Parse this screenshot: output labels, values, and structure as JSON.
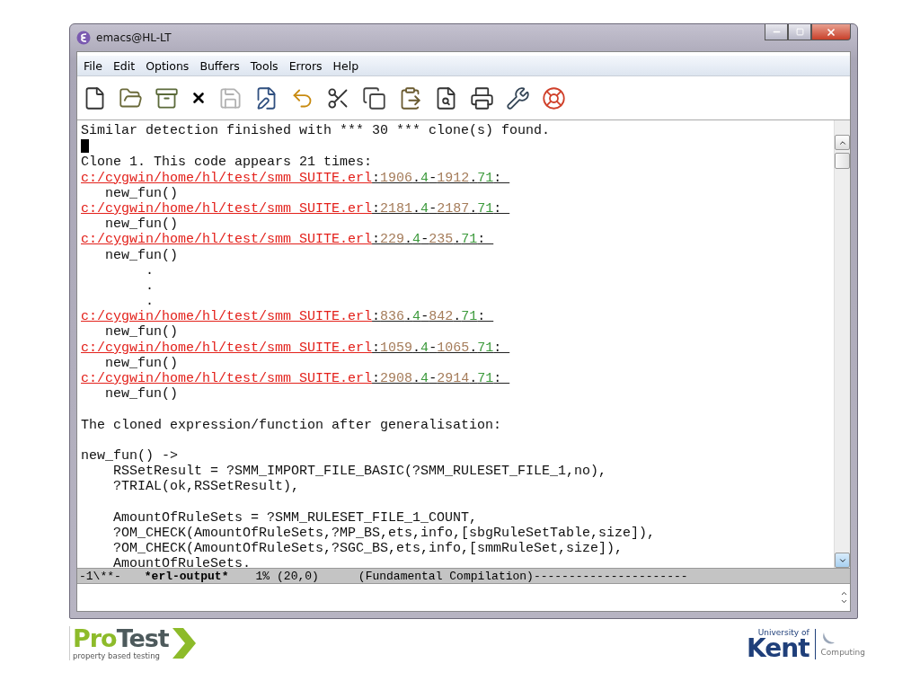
{
  "window": {
    "title": "emacs@HL-LT"
  },
  "menu": [
    "File",
    "Edit",
    "Options",
    "Buffers",
    "Tools",
    "Errors",
    "Help"
  ],
  "toolbar": [
    {
      "kind": "new",
      "disabled": false
    },
    {
      "kind": "open",
      "disabled": false
    },
    {
      "kind": "dired",
      "disabled": false
    },
    {
      "kind": "close",
      "disabled": false
    },
    {
      "kind": "save",
      "disabled": true
    },
    {
      "kind": "saveas",
      "disabled": false
    },
    {
      "kind": "undo",
      "disabled": false
    },
    {
      "kind": "cut",
      "disabled": false
    },
    {
      "kind": "copy",
      "disabled": false
    },
    {
      "kind": "paste",
      "disabled": false
    },
    {
      "kind": "search",
      "disabled": false
    },
    {
      "kind": "print",
      "disabled": false
    },
    {
      "kind": "preferences",
      "disabled": false
    },
    {
      "kind": "help",
      "disabled": false
    }
  ],
  "buffer": [
    {
      "kind": "text",
      "text": "Similar detection finished with *** 30 *** clone(s) found."
    },
    {
      "kind": "cursor"
    },
    {
      "kind": "text",
      "text": "Clone 1. This code appears 21 times:"
    },
    {
      "kind": "location",
      "path": "c:/cygwin/home/hl/test/smm_SUITE.erl",
      "parts": [
        {
          "kind": "sep",
          "text": ":"
        },
        {
          "kind": "line",
          "text": "1906"
        },
        {
          "kind": "sep",
          "text": "."
        },
        {
          "kind": "col",
          "text": "4"
        },
        {
          "kind": "sep",
          "text": "-"
        },
        {
          "kind": "line",
          "text": "1912"
        },
        {
          "kind": "sep",
          "text": "."
        },
        {
          "kind": "col",
          "text": "71"
        },
        {
          "kind": "sep",
          "text": ": "
        }
      ]
    },
    {
      "kind": "text",
      "text": "   new_fun()"
    },
    {
      "kind": "location",
      "path": "c:/cygwin/home/hl/test/smm_SUITE.erl",
      "parts": [
        {
          "kind": "sep",
          "text": ":"
        },
        {
          "kind": "line",
          "text": "2181"
        },
        {
          "kind": "sep",
          "text": "."
        },
        {
          "kind": "col",
          "text": "4"
        },
        {
          "kind": "sep",
          "text": "-"
        },
        {
          "kind": "line",
          "text": "2187"
        },
        {
          "kind": "sep",
          "text": "."
        },
        {
          "kind": "col",
          "text": "71"
        },
        {
          "kind": "sep",
          "text": ": "
        }
      ]
    },
    {
      "kind": "text",
      "text": "   new_fun()"
    },
    {
      "kind": "location",
      "path": "c:/cygwin/home/hl/test/smm_SUITE.erl",
      "parts": [
        {
          "kind": "sep",
          "text": ":"
        },
        {
          "kind": "line",
          "text": "229"
        },
        {
          "kind": "sep",
          "text": "."
        },
        {
          "kind": "col",
          "text": "4"
        },
        {
          "kind": "sep",
          "text": "-"
        },
        {
          "kind": "line",
          "text": "235"
        },
        {
          "kind": "sep",
          "text": "."
        },
        {
          "kind": "col",
          "text": "71"
        },
        {
          "kind": "sep",
          "text": ": "
        }
      ]
    },
    {
      "kind": "text",
      "text": "   new_fun()"
    },
    {
      "kind": "text",
      "text": "        ."
    },
    {
      "kind": "text",
      "text": "        ."
    },
    {
      "kind": "text",
      "text": "        ."
    },
    {
      "kind": "location",
      "path": "c:/cygwin/home/hl/test/smm_SUITE.erl",
      "parts": [
        {
          "kind": "sep",
          "text": ":"
        },
        {
          "kind": "line",
          "text": "836"
        },
        {
          "kind": "sep",
          "text": "."
        },
        {
          "kind": "col",
          "text": "4"
        },
        {
          "kind": "sep",
          "text": "-"
        },
        {
          "kind": "line",
          "text": "842"
        },
        {
          "kind": "sep",
          "text": "."
        },
        {
          "kind": "col",
          "text": "71"
        },
        {
          "kind": "sep",
          "text": ": "
        }
      ]
    },
    {
      "kind": "text",
      "text": "   new_fun()"
    },
    {
      "kind": "location",
      "path": "c:/cygwin/home/hl/test/smm_SUITE.erl",
      "parts": [
        {
          "kind": "sep",
          "text": ":"
        },
        {
          "kind": "line",
          "text": "1059"
        },
        {
          "kind": "sep",
          "text": "."
        },
        {
          "kind": "col",
          "text": "4"
        },
        {
          "kind": "sep",
          "text": "-"
        },
        {
          "kind": "line",
          "text": "1065"
        },
        {
          "kind": "sep",
          "text": "."
        },
        {
          "kind": "col",
          "text": "71"
        },
        {
          "kind": "sep",
          "text": ": "
        }
      ]
    },
    {
      "kind": "text",
      "text": "   new_fun()"
    },
    {
      "kind": "location",
      "path": "c:/cygwin/home/hl/test/smm_SUITE.erl",
      "parts": [
        {
          "kind": "sep",
          "text": ":"
        },
        {
          "kind": "line",
          "text": "2908"
        },
        {
          "kind": "sep",
          "text": "."
        },
        {
          "kind": "col",
          "text": "4"
        },
        {
          "kind": "sep",
          "text": "-"
        },
        {
          "kind": "line",
          "text": "2914"
        },
        {
          "kind": "sep",
          "text": "."
        },
        {
          "kind": "col",
          "text": "71"
        },
        {
          "kind": "sep",
          "text": ": "
        }
      ]
    },
    {
      "kind": "text",
      "text": "   new_fun()"
    },
    {
      "kind": "blank"
    },
    {
      "kind": "text",
      "text": "The cloned expression/function after generalisation:"
    },
    {
      "kind": "blank"
    },
    {
      "kind": "text",
      "text": "new_fun() ->"
    },
    {
      "kind": "text",
      "text": "    RSSetResult = ?SMM_IMPORT_FILE_BASIC(?SMM_RULESET_FILE_1,no),"
    },
    {
      "kind": "text",
      "text": "    ?TRIAL(ok,RSSetResult),"
    },
    {
      "kind": "blank"
    },
    {
      "kind": "text",
      "text": "    AmountOfRuleSets = ?SMM_RULESET_FILE_1_COUNT,"
    },
    {
      "kind": "text",
      "text": "    ?OM_CHECK(AmountOfRuleSets,?MP_BS,ets,info,[sbgRuleSetTable,size]),"
    },
    {
      "kind": "text",
      "text": "    ?OM_CHECK(AmountOfRuleSets,?SGC_BS,ets,info,[smmRuleSet,size]),"
    },
    {
      "kind": "text",
      "text": "    AmountOfRuleSets."
    }
  ],
  "mode_line": {
    "status": "-1\\**-",
    "buffer_name": "*erl-output*",
    "percent": "1%",
    "position": "(20,0)",
    "modes": "(Fundamental Compilation)",
    "fill": "----------------------"
  },
  "footer": {
    "protest": {
      "pro": "Pro",
      "test": "Test",
      "tagline": "property based testing"
    },
    "kent": {
      "university": "University of",
      "name": "Kent",
      "department": "Computing"
    }
  }
}
